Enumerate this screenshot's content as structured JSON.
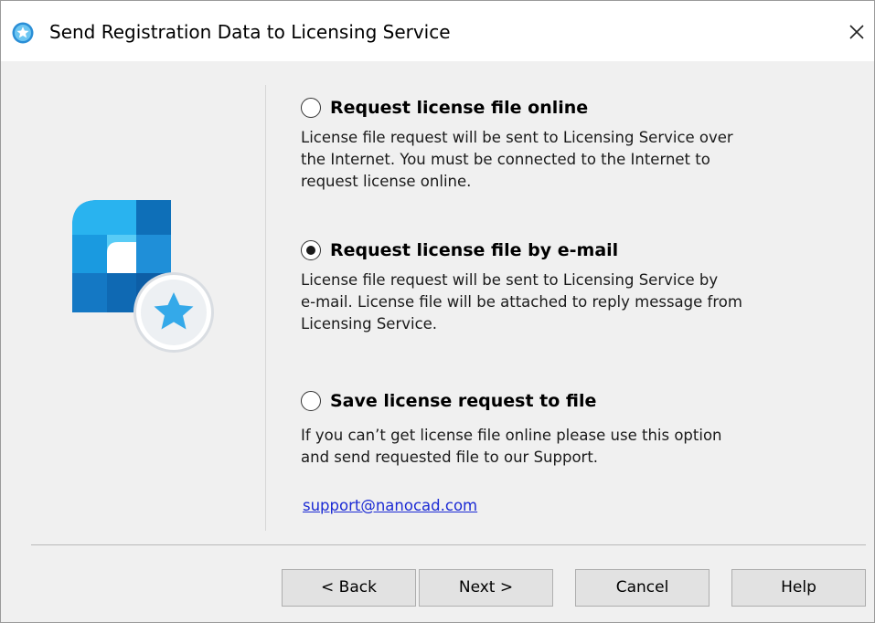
{
  "window": {
    "title": "Send Registration Data to Licensing Service",
    "close_glyph": "×"
  },
  "options": [
    {
      "label": "Request license file online",
      "selected": false,
      "description": [
        "License file request will be sent to Licensing Service over",
        "the Internet. You must be connected to the Internet to",
        "request license online."
      ]
    },
    {
      "label": "Request license file by e-mail",
      "selected": true,
      "description": [
        "License file request will be sent to Licensing Service by",
        "e-mail. License file will be attached to reply message from",
        "Licensing Service."
      ]
    },
    {
      "label": "Save license request to file",
      "selected": false,
      "description": [
        "If you can’t get license file online please use this option",
        "and send requested file to our Support."
      ]
    }
  ],
  "support_link": "support@nanocad.com",
  "buttons": {
    "back": "< Back",
    "next": "Next >",
    "cancel": "Cancel",
    "help": "Help"
  },
  "icons": {
    "app": "star-badge-icon",
    "close": "close-icon",
    "logo": "nanocad-logo-icon"
  },
  "colors": {
    "dialog_bg": "#f0f0f0",
    "title_bg": "#ffffff",
    "link": "#1c2bd4",
    "logo_blue": "#1a8fd6"
  }
}
